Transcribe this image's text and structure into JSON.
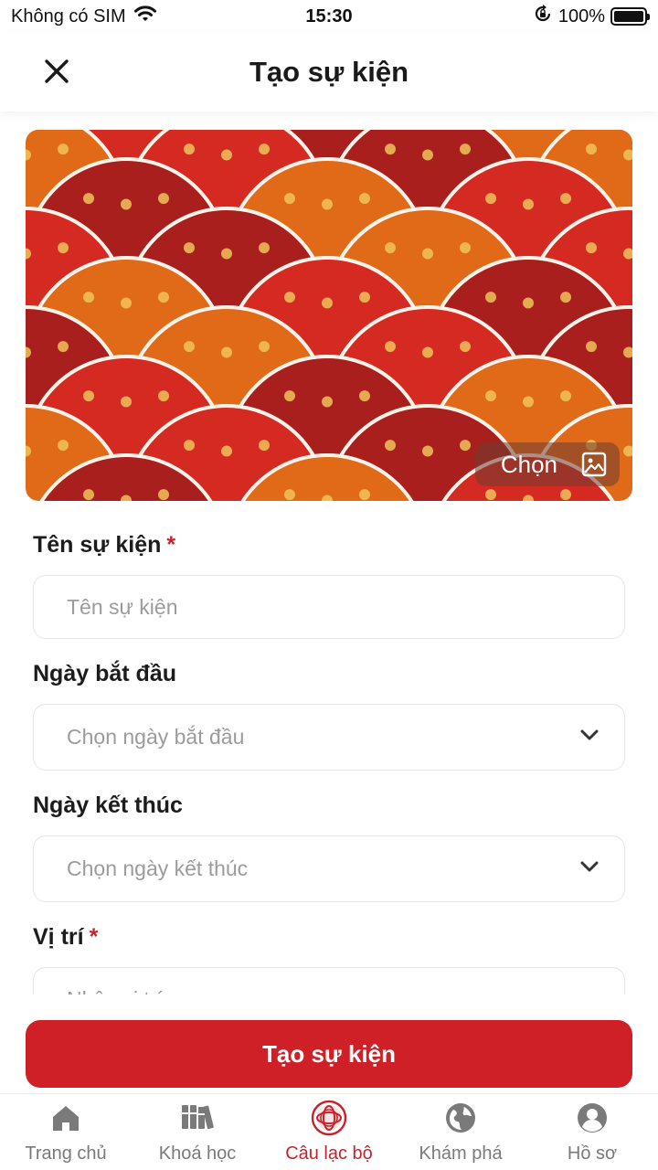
{
  "status_bar": {
    "carrier": "Không có SIM",
    "time": "15:30",
    "battery_percent": "100%",
    "battery_level": 1.0,
    "icons": [
      "wifi-icon",
      "orientation-lock-icon",
      "battery-icon"
    ]
  },
  "header": {
    "title": "Tạo sự kiện",
    "close_icon": "close-icon"
  },
  "cover": {
    "choose_label": "Chọn",
    "choose_icon": "image-icon",
    "palette": [
      "#d42a22",
      "#a91f1e",
      "#e06a18",
      "#f0c25a"
    ]
  },
  "form": {
    "name": {
      "label": "Tên sự kiện",
      "required": "*",
      "placeholder": "Tên sự kiện"
    },
    "start_date": {
      "label": "Ngày bắt đầu",
      "placeholder": "Chọn ngày bắt đầu"
    },
    "end_date": {
      "label": "Ngày kết thúc",
      "placeholder": "Chọn ngày kết thúc"
    },
    "location": {
      "label": "Vị trí",
      "required": "*",
      "placeholder": "Nhập vị trí"
    }
  },
  "submit_label": "Tạo sự kiện",
  "colors": {
    "accent": "#cf2027",
    "placeholder": "#9b9b9b",
    "tab_inactive": "#7a7a7a"
  },
  "tabs": [
    {
      "label": "Trang chủ",
      "icon": "home-icon",
      "active": false
    },
    {
      "label": "Khoá học",
      "icon": "books-icon",
      "active": false
    },
    {
      "label": "Câu lạc bộ",
      "icon": "club-icon",
      "active": true
    },
    {
      "label": "Khám phá",
      "icon": "globe-icon",
      "active": false
    },
    {
      "label": "Hồ sơ",
      "icon": "profile-icon",
      "active": false
    }
  ]
}
